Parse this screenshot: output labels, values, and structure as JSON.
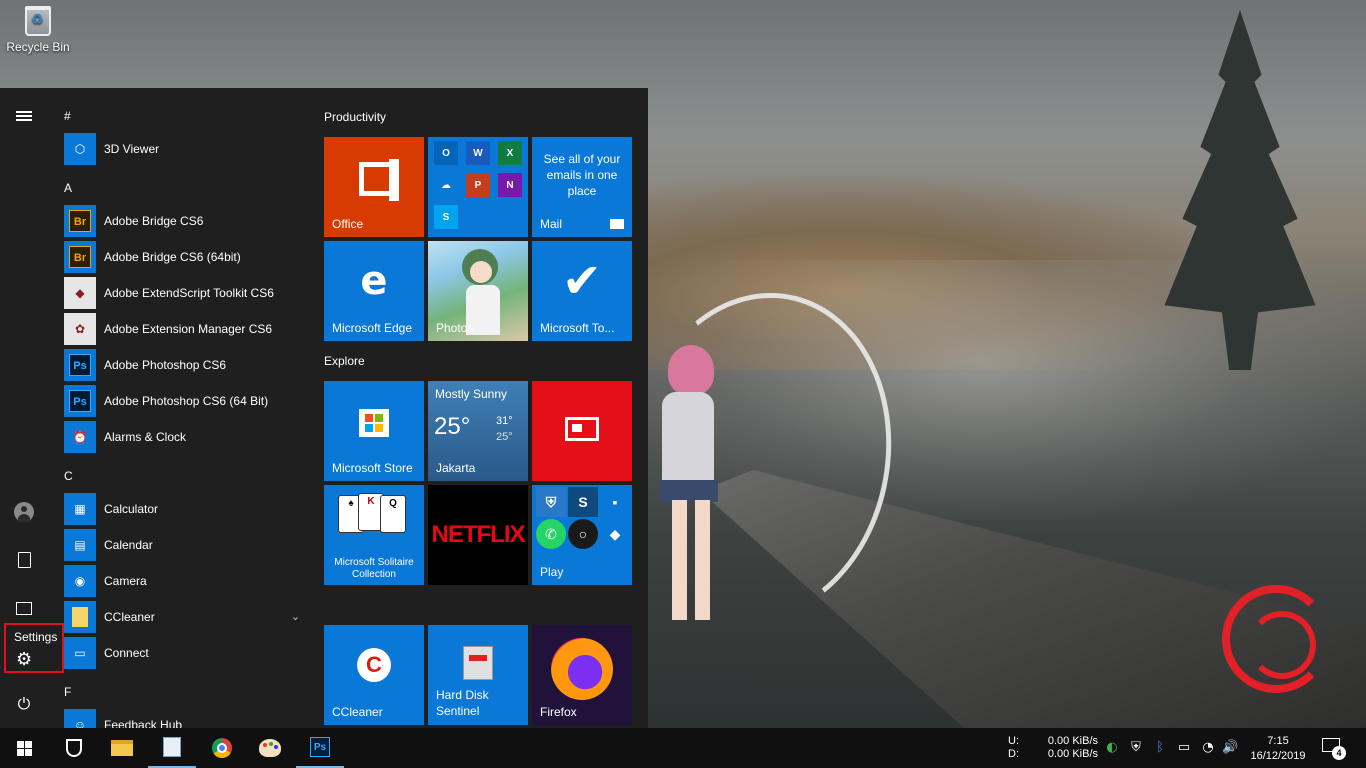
{
  "desktop": {
    "recycle_bin_label": "Recycle Bin"
  },
  "start_menu": {
    "rail": {
      "settings_tooltip": "Settings"
    },
    "app_list": {
      "headers": [
        "#",
        "A",
        "C",
        "F"
      ],
      "apps": [
        {
          "name": "3D Viewer",
          "icon": "cube-icon"
        },
        {
          "name": "Adobe Bridge CS6",
          "icon": "bridge-icon",
          "icon_text": "Br"
        },
        {
          "name": "Adobe Bridge CS6 (64bit)",
          "icon": "bridge-icon",
          "icon_text": "Br"
        },
        {
          "name": "Adobe ExtendScript Toolkit CS6",
          "icon": "extendscript-icon"
        },
        {
          "name": "Adobe Extension Manager CS6",
          "icon": "extension-manager-icon"
        },
        {
          "name": "Adobe Photoshop CS6",
          "icon": "photoshop-icon",
          "icon_text": "Ps"
        },
        {
          "name": "Adobe Photoshop CS6 (64 Bit)",
          "icon": "photoshop-icon",
          "icon_text": "Ps"
        },
        {
          "name": "Alarms & Clock",
          "icon": "alarm-clock-icon"
        },
        {
          "name": "Calculator",
          "icon": "calculator-icon"
        },
        {
          "name": "Calendar",
          "icon": "calendar-icon"
        },
        {
          "name": "Camera",
          "icon": "camera-icon"
        },
        {
          "name": "CCleaner",
          "icon": "folder-icon"
        },
        {
          "name": "Connect",
          "icon": "connect-icon"
        },
        {
          "name": "Feedback Hub",
          "icon": "feedback-icon"
        }
      ]
    },
    "tiles": {
      "group_productivity": "Productivity",
      "group_explore": "Explore",
      "office": "Office",
      "office_apps": [
        "O",
        "W",
        "X",
        "",
        "P",
        "N",
        "S"
      ],
      "mail_text": "See all of your emails in one place",
      "mail": "Mail",
      "edge": "Microsoft Edge",
      "photos": "Photos",
      "todo": "Microsoft To...",
      "store": "Microsoft Store",
      "weather_condition": "Mostly Sunny",
      "weather_temp": "25°",
      "weather_high": "31°",
      "weather_low": "25°",
      "weather_city": "Jakarta",
      "solitaire": "Microsoft Solitaire Collection",
      "netflix": "NETFLIX",
      "play": "Play",
      "ccleaner": "CCleaner",
      "hdd": "Hard Disk Sentinel",
      "firefox": "Firefox"
    }
  },
  "taskbar": {
    "upload_label": "U:",
    "download_label": "D:",
    "upload_speed": "0.00 KiB/s",
    "download_speed": "0.00 KiB/s",
    "time": "7:15",
    "date": "16/12/2019",
    "notification_count": "4"
  },
  "colors": {
    "accent": "#0a78d7",
    "office": "#d83b01",
    "news": "#e40f17",
    "highlight_box": "#e0111b"
  }
}
